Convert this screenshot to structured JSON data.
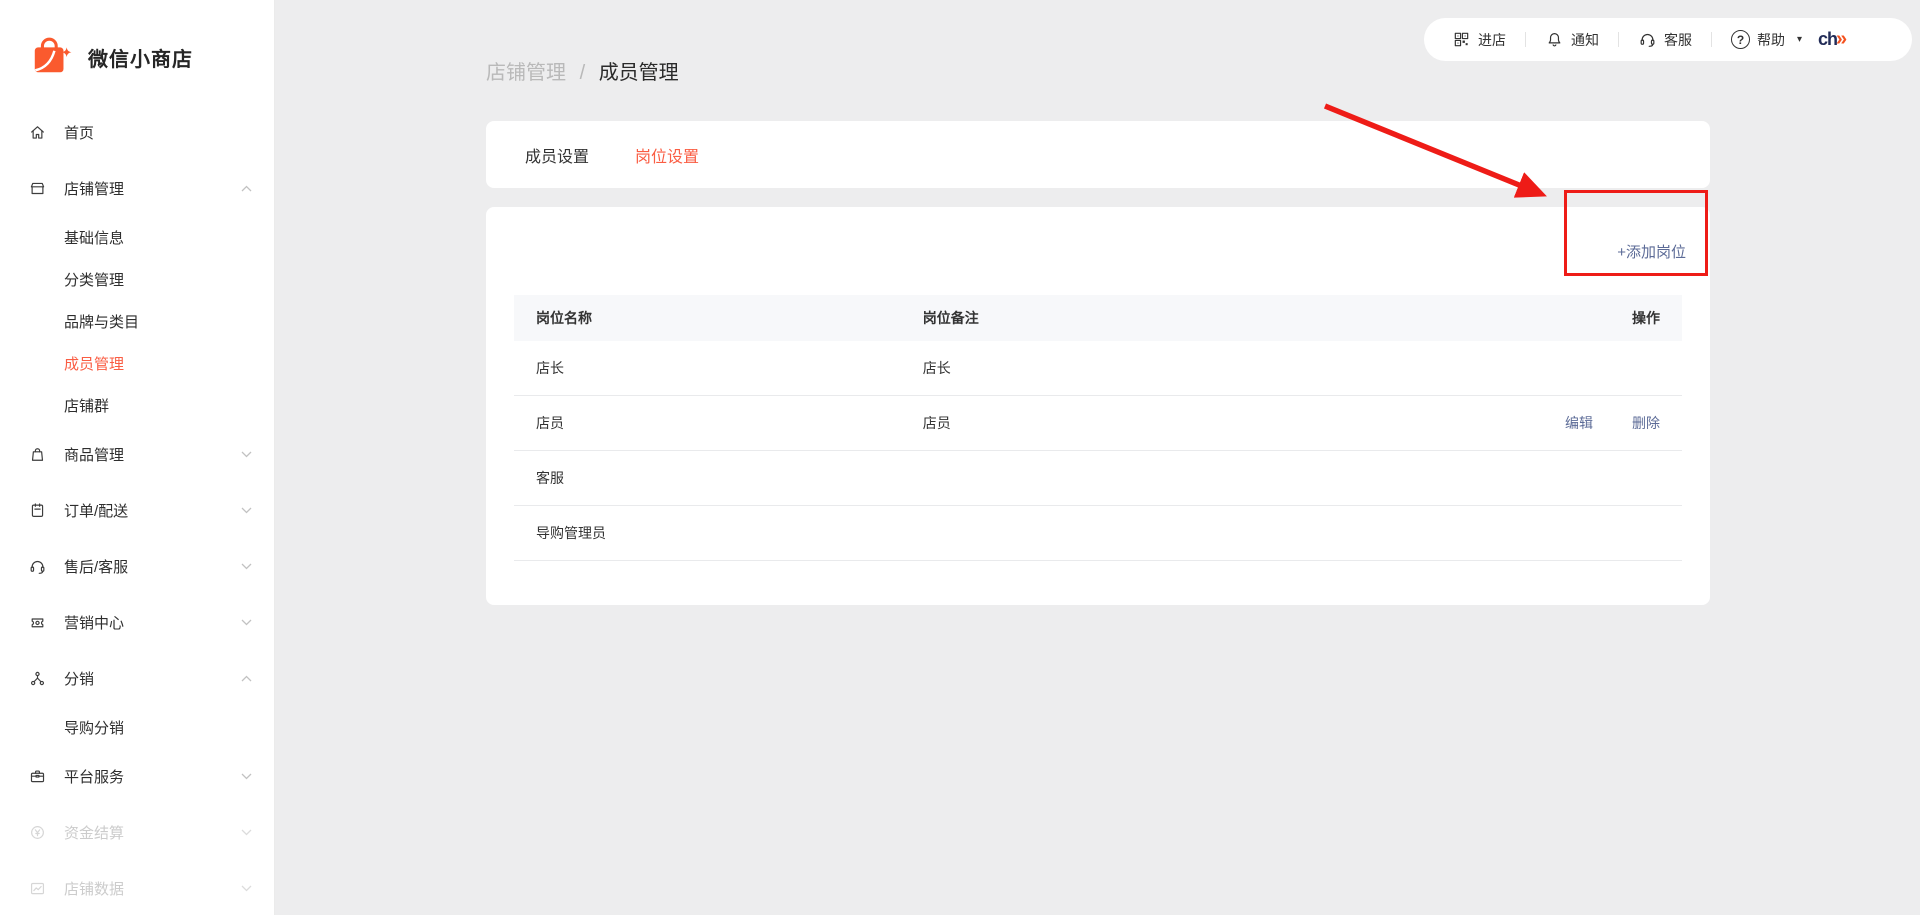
{
  "colors": {
    "accent": "#fa5d43",
    "link": "#5c6b97",
    "annotation_red": "#ee1c17",
    "brand_orange": "#fa5a2e"
  },
  "brand": {
    "name": "微信小商店"
  },
  "topbar": {
    "items": [
      {
        "key": "enter-store",
        "label": "进店",
        "icon": "qr-code-icon"
      },
      {
        "key": "notifications",
        "label": "通知",
        "icon": "bell-icon"
      },
      {
        "key": "customer-service",
        "label": "客服",
        "icon": "headset-icon"
      },
      {
        "key": "help",
        "label": "帮助",
        "icon": "question-icon",
        "has_dropdown": true
      }
    ],
    "plugin_logo_text": "ch",
    "plugin_logo_arrow": "»"
  },
  "breadcrumb": {
    "parent": "店铺管理",
    "separator": "/",
    "current": "成员管理"
  },
  "sidebar": {
    "items": [
      {
        "key": "home",
        "label": "首页",
        "icon": "home-icon"
      },
      {
        "key": "shop-manage",
        "label": "店铺管理",
        "icon": "storefront-icon",
        "expanded": true,
        "children": [
          {
            "key": "basic-info",
            "label": "基础信息"
          },
          {
            "key": "category-manage",
            "label": "分类管理"
          },
          {
            "key": "brand-category",
            "label": "品牌与类目"
          },
          {
            "key": "member-manage",
            "label": "成员管理",
            "active": true
          },
          {
            "key": "shop-group",
            "label": "店铺群"
          }
        ]
      },
      {
        "key": "goods-manage",
        "label": "商品管理",
        "icon": "bag-icon",
        "expanded": false
      },
      {
        "key": "order-delivery",
        "label": "订单/配送",
        "icon": "clipboard-icon",
        "expanded": false
      },
      {
        "key": "aftersale-service",
        "label": "售后/客服",
        "icon": "headset-icon",
        "expanded": false
      },
      {
        "key": "marketing-center",
        "label": "营销中心",
        "icon": "ticket-icon",
        "expanded": false
      },
      {
        "key": "distribution",
        "label": "分销",
        "icon": "share-network-icon",
        "expanded": true,
        "children": [
          {
            "key": "guide-distribution",
            "label": "导购分销"
          }
        ]
      },
      {
        "key": "platform-service",
        "label": "平台服务",
        "icon": "briefcase-icon",
        "expanded": false
      },
      {
        "key": "funds-settlement",
        "label": "资金结算",
        "icon": "yen-circle-icon",
        "expanded": false,
        "disabled": true
      },
      {
        "key": "shop-data",
        "label": "店铺数据",
        "icon": "chart-icon",
        "expanded": false,
        "disabled": true
      }
    ]
  },
  "tabs": [
    {
      "key": "member-settings",
      "label": "成员设置"
    },
    {
      "key": "position-settings",
      "label": "岗位设置",
      "active": true
    }
  ],
  "panel": {
    "add_button": "+添加岗位"
  },
  "table": {
    "columns": [
      "岗位名称",
      "岗位备注",
      "操作"
    ],
    "rows": [
      {
        "name": "店长",
        "note": "店长",
        "actions": []
      },
      {
        "name": "店员",
        "note": "店员",
        "actions": [
          {
            "key": "edit",
            "label": "编辑"
          },
          {
            "key": "delete",
            "label": "删除"
          }
        ]
      },
      {
        "name": "客服",
        "note": "",
        "actions": []
      },
      {
        "name": "导购管理员",
        "note": "",
        "actions": []
      }
    ]
  }
}
